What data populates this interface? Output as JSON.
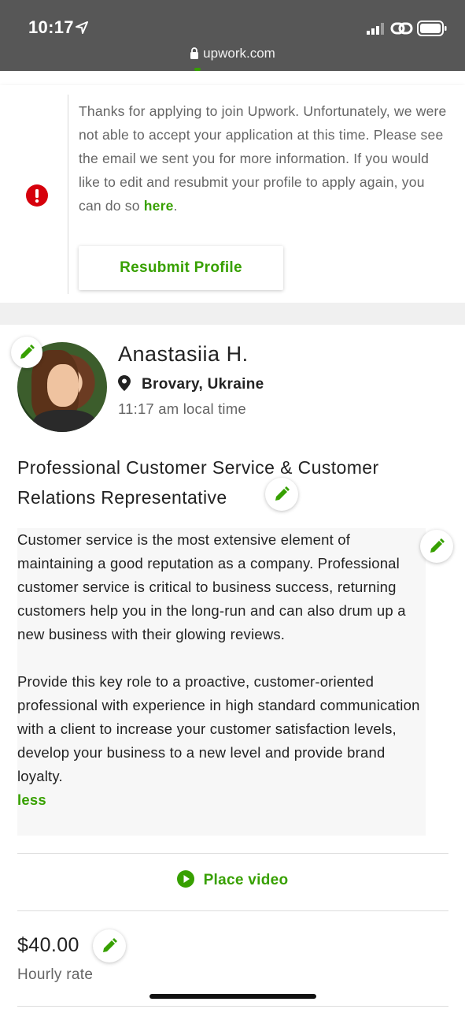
{
  "status_bar": {
    "time": "10:17",
    "url": "upwork.com"
  },
  "notice": {
    "message_main": "Thanks for applying to join Upwork. Unfortunately, we were not able to accept your application at this time. Please see the email we sent you for more information. If you would like to edit and resubmit your profile to apply again, you can do so ",
    "message_link": "here",
    "message_end": ".",
    "button_label": "Resubmit Profile"
  },
  "profile": {
    "name": "Anastasiia H.",
    "location": "Brovary, Ukraine",
    "local_time": "11:17 am local time",
    "title": "Professional Customer Service & Customer Relations Representative",
    "description_p1": "Customer service is the most extensive element of maintaining a good reputation as a company. Professional customer service is critical to business success, returning customers help you in the long-run and can also drum up a new business with their glowing reviews.",
    "description_p2": "Provide this key role to a proactive, customer-oriented professional with experience in high standard communication with a client to increase your customer satisfaction levels, develop your business to a new level and provide brand loyalty.",
    "less_label": "less",
    "place_video_label": "Place video",
    "hourly_rate": "$40.00",
    "hourly_rate_label": "Hourly rate"
  },
  "colors": {
    "accent": "#37a000",
    "alert": "#d6000c"
  }
}
